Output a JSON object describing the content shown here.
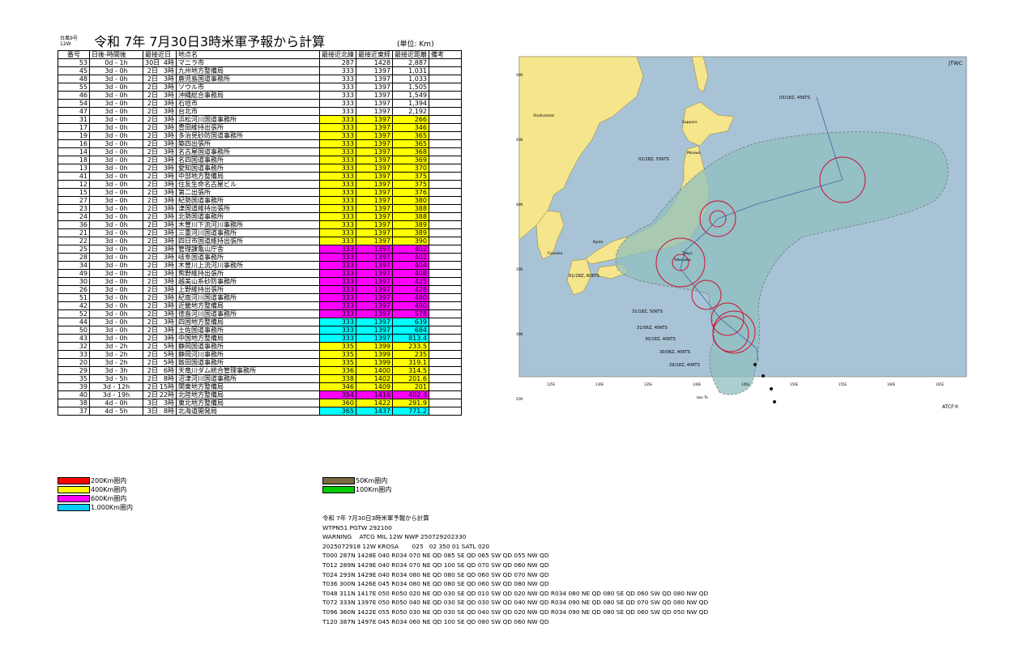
{
  "header": {
    "small_line1": "台風9号",
    "small_line2": "12W",
    "title": "令和 7年 7月30日3時米軍予報から計算",
    "unit": "(単位: Km)"
  },
  "table": {
    "columns": [
      "番号",
      "日後-時間後",
      "最接近日",
      "地点名",
      "最接近北緯",
      "最接近東経",
      "最接近距離",
      "備考"
    ],
    "rows": [
      {
        "no": "53",
        "offset": "0d - 1h",
        "day": "30日",
        "hour": "4時",
        "name": "マニラ市",
        "lat": "287",
        "lon": "1428",
        "dist": "2,887",
        "color": ""
      },
      {
        "no": "45",
        "offset": "3d - 0h",
        "day": "2日",
        "hour": "3時",
        "name": "九州地方整備局",
        "lat": "333",
        "lon": "1397",
        "dist": "1,031",
        "color": ""
      },
      {
        "no": "48",
        "offset": "3d - 0h",
        "day": "2日",
        "hour": "3時",
        "name": "鹿児島国道事務所",
        "lat": "333",
        "lon": "1397",
        "dist": "1,033",
        "color": ""
      },
      {
        "no": "55",
        "offset": "3d - 0h",
        "day": "2日",
        "hour": "3時",
        "name": "ソウル市",
        "lat": "333",
        "lon": "1397",
        "dist": "1,505",
        "color": ""
      },
      {
        "no": "46",
        "offset": "3d - 0h",
        "day": "2日",
        "hour": "3時",
        "name": "沖縄総合事務局",
        "lat": "333",
        "lon": "1397",
        "dist": "1,549",
        "color": ""
      },
      {
        "no": "54",
        "offset": "3d - 0h",
        "day": "2日",
        "hour": "3時",
        "name": "石垣市",
        "lat": "333",
        "lon": "1397",
        "dist": "1,394",
        "color": ""
      },
      {
        "no": "47",
        "offset": "3d - 0h",
        "day": "2日",
        "hour": "3時",
        "name": "台北市",
        "lat": "333",
        "lon": "1397",
        "dist": "2,192",
        "color": ""
      },
      {
        "no": "31",
        "offset": "3d - 0h",
        "day": "2日",
        "hour": "3時",
        "name": "浜松河川国道事務所",
        "lat": "333",
        "lon": "1397",
        "dist": "266",
        "color": "yellow"
      },
      {
        "no": "17",
        "offset": "3d - 0h",
        "day": "2日",
        "hour": "3時",
        "name": "豊田維持出張所",
        "lat": "333",
        "lon": "1397",
        "dist": "346",
        "color": "yellow"
      },
      {
        "no": "19",
        "offset": "3d - 0h",
        "day": "2日",
        "hour": "3時",
        "name": "多治見砂防国道事務所",
        "lat": "333",
        "lon": "1397",
        "dist": "365",
        "color": "yellow"
      },
      {
        "no": "16",
        "offset": "3d - 0h",
        "day": "2日",
        "hour": "3時",
        "name": "築四出張所",
        "lat": "333",
        "lon": "1397",
        "dist": "365",
        "color": "yellow"
      },
      {
        "no": "14",
        "offset": "3d - 0h",
        "day": "2日",
        "hour": "3時",
        "name": "名古屋国道事務所",
        "lat": "333",
        "lon": "1397",
        "dist": "368",
        "color": "yellow"
      },
      {
        "no": "18",
        "offset": "3d - 0h",
        "day": "2日",
        "hour": "3時",
        "name": "名四国道事務所",
        "lat": "333",
        "lon": "1397",
        "dist": "369",
        "color": "yellow"
      },
      {
        "no": "13",
        "offset": "3d - 0h",
        "day": "2日",
        "hour": "3時",
        "name": "愛知国道事務所",
        "lat": "333",
        "lon": "1397",
        "dist": "370",
        "color": "yellow"
      },
      {
        "no": "41",
        "offset": "3d - 0h",
        "day": "2日",
        "hour": "3時",
        "name": "中部地方整備局",
        "lat": "333",
        "lon": "1397",
        "dist": "375",
        "color": "yellow"
      },
      {
        "no": "12",
        "offset": "3d - 0h",
        "day": "2日",
        "hour": "3時",
        "name": "住友生命名古屋ビル",
        "lat": "333",
        "lon": "1397",
        "dist": "375",
        "color": "yellow"
      },
      {
        "no": "15",
        "offset": "3d - 0h",
        "day": "2日",
        "hour": "3時",
        "name": "第二出張所",
        "lat": "333",
        "lon": "1397",
        "dist": "376",
        "color": "yellow"
      },
      {
        "no": "27",
        "offset": "3d - 0h",
        "day": "2日",
        "hour": "3時",
        "name": "紀勢国道事務所",
        "lat": "333",
        "lon": "1397",
        "dist": "380",
        "color": "yellow"
      },
      {
        "no": "23",
        "offset": "3d - 0h",
        "day": "2日",
        "hour": "3時",
        "name": "津国道維持出張所",
        "lat": "333",
        "lon": "1397",
        "dist": "388",
        "color": "yellow"
      },
      {
        "no": "24",
        "offset": "3d - 0h",
        "day": "2日",
        "hour": "3時",
        "name": "北勢国道事務所",
        "lat": "333",
        "lon": "1397",
        "dist": "388",
        "color": "yellow"
      },
      {
        "no": "36",
        "offset": "3d - 0h",
        "day": "2日",
        "hour": "3時",
        "name": "木曽川下流河川事務所",
        "lat": "333",
        "lon": "1397",
        "dist": "389",
        "color": "yellow"
      },
      {
        "no": "21",
        "offset": "3d - 0h",
        "day": "2日",
        "hour": "3時",
        "name": "三重河川国道事務所",
        "lat": "333",
        "lon": "1397",
        "dist": "389",
        "color": "yellow"
      },
      {
        "no": "22",
        "offset": "3d - 0h",
        "day": "2日",
        "hour": "3時",
        "name": "四日市国道維持出張所",
        "lat": "333",
        "lon": "1397",
        "dist": "390",
        "color": "yellow"
      },
      {
        "no": "25",
        "offset": "3d - 0h",
        "day": "2日",
        "hour": "3時",
        "name": "管理課亀山庁舎",
        "lat": "333",
        "lon": "1397",
        "dist": "402",
        "color": "magenta"
      },
      {
        "no": "28",
        "offset": "3d - 0h",
        "day": "2日",
        "hour": "3時",
        "name": "岐阜国道事務所",
        "lat": "333",
        "lon": "1397",
        "dist": "402",
        "color": "magenta"
      },
      {
        "no": "34",
        "offset": "3d - 0h",
        "day": "2日",
        "hour": "3時",
        "name": "木曽川上流河川事務所",
        "lat": "333",
        "lon": "1397",
        "dist": "404",
        "color": "magenta"
      },
      {
        "no": "49",
        "offset": "3d - 0h",
        "day": "2日",
        "hour": "3時",
        "name": "熊野維持出張所",
        "lat": "333",
        "lon": "1397",
        "dist": "408",
        "color": "magenta"
      },
      {
        "no": "30",
        "offset": "3d - 0h",
        "day": "2日",
        "hour": "3時",
        "name": "越美山系砂防事務所",
        "lat": "333",
        "lon": "1397",
        "dist": "425",
        "color": "magenta"
      },
      {
        "no": "26",
        "offset": "3d - 0h",
        "day": "2日",
        "hour": "3時",
        "name": "上野維持出張所",
        "lat": "333",
        "lon": "1397",
        "dist": "428",
        "color": "magenta"
      },
      {
        "no": "51",
        "offset": "3d - 0h",
        "day": "2日",
        "hour": "3時",
        "name": "紀南河川国道事務所",
        "lat": "333",
        "lon": "1397",
        "dist": "480",
        "color": "magenta"
      },
      {
        "no": "42",
        "offset": "3d - 0h",
        "day": "2日",
        "hour": "3時",
        "name": "近畿地方整備局",
        "lat": "333",
        "lon": "1397",
        "dist": "490",
        "color": "magenta"
      },
      {
        "no": "52",
        "offset": "3d - 0h",
        "day": "2日",
        "hour": "3時",
        "name": "徳島河川国道事務所",
        "lat": "333",
        "lon": "1397",
        "dist": "578",
        "color": "magenta"
      },
      {
        "no": "44",
        "offset": "3d - 0h",
        "day": "2日",
        "hour": "3時",
        "name": "四国地方整備局",
        "lat": "333",
        "lon": "1397",
        "dist": "639",
        "color": "cyan"
      },
      {
        "no": "50",
        "offset": "3d - 0h",
        "day": "2日",
        "hour": "3時",
        "name": "土佐国道事務所",
        "lat": "333",
        "lon": "1397",
        "dist": "684",
        "color": "cyan"
      },
      {
        "no": "43",
        "offset": "3d - 0h",
        "day": "2日",
        "hour": "3時",
        "name": "中国地方整備局",
        "lat": "333",
        "lon": "1397",
        "dist": "813.4",
        "color": "cyan"
      },
      {
        "no": "32",
        "offset": "3d - 2h",
        "day": "2日",
        "hour": "5時",
        "name": "静岡国道事務所",
        "lat": "335",
        "lon": "1399",
        "dist": "233.5",
        "color": "yellow"
      },
      {
        "no": "33",
        "offset": "3d - 2h",
        "day": "2日",
        "hour": "5時",
        "name": "静岡河川事務所",
        "lat": "335",
        "lon": "1399",
        "dist": "235",
        "color": "yellow"
      },
      {
        "no": "20",
        "offset": "3d - 2h",
        "day": "2日",
        "hour": "5時",
        "name": "飯田国道事務所",
        "lat": "335",
        "lon": "1399",
        "dist": "319.1",
        "color": "yellow"
      },
      {
        "no": "29",
        "offset": "3d - 3h",
        "day": "2日",
        "hour": "6時",
        "name": "天竜川ダム統合管理事務所",
        "lat": "336",
        "lon": "1400",
        "dist": "314.5",
        "color": "yellow"
      },
      {
        "no": "35",
        "offset": "3d - 5h",
        "day": "2日",
        "hour": "8時",
        "name": "沼津河川国道事務所",
        "lat": "338",
        "lon": "1402",
        "dist": "201.6",
        "color": "yellow"
      },
      {
        "no": "39",
        "offset": "3d - 12h",
        "day": "2日",
        "hour": "15時",
        "name": "関東地方整備局",
        "lat": "346",
        "lon": "1409",
        "dist": "201",
        "color": "yellow"
      },
      {
        "no": "40",
        "offset": "3d - 19h",
        "day": "2日",
        "hour": "22時",
        "name": "北陸地方整備局",
        "lat": "354",
        "lon": "1416",
        "dist": "402.4",
        "color": "magenta"
      },
      {
        "no": "38",
        "offset": "4d - 0h",
        "day": "3日",
        "hour": "3時",
        "name": "東北地方整備局",
        "lat": "360",
        "lon": "1422",
        "dist": "291.9",
        "color": "yellow"
      },
      {
        "no": "37",
        "offset": "4d - 5h",
        "day": "3日",
        "hour": "8時",
        "name": "北海道開発局",
        "lat": "365",
        "lon": "1437",
        "dist": "771.2",
        "color": "cyan"
      }
    ]
  },
  "legend": [
    {
      "label": "200Km圏内",
      "color": "#ff0000"
    },
    {
      "label": "400Km圏内",
      "color": "#ffff00"
    },
    {
      "label": "600Km圏内",
      "color": "#ff00ff"
    },
    {
      "label": "1,000Km圏内",
      "color": "#00ccff"
    },
    {
      "label": "50Km圏内",
      "color": "#7a6a40"
    },
    {
      "label": "100Km圏内",
      "color": "#00cc00"
    }
  ],
  "colors": {
    "yellow": "#ffff00",
    "magenta": "#ff00ff",
    "cyan": "#00ffff"
  },
  "bulletin": [
    "令和 7年 7月30日3時米軍予報から計算",
    "WTPN51 PGTW 292100",
    "WARNING    ATCG MIL 12W NWP 250729202330",
    "2025072918 12W KROSA       025   02 350 01 SATL 020",
    "T000 287N 1428E 040 R034 070 NE QD 085 SE QD 065 SW QD 055 NW QD",
    "T012 289N 1429E 040 R034 070 NE QD 100 SE QD 070 SW QD 060 NW QD",
    "T024 293N 1429E 040 R034 080 NE QD 080 SE QD 060 SW QD 070 NW QD",
    "T036 300N 1426E 045 R034 080 NE QD 080 SE QD 060 SW QD 080 NW QD",
    "T048 311N 1417E 050 R050 020 NE QD 030 SE QD 010 SW QD 020 NW QD R034 080 NE QD 080 SE QD 060 SW QD 080 NW QD",
    "T072 333N 1397E 050 R050 040 NE QD 030 SE QD 030 SW QD 040 NW QD R034 090 NE QD 080 SE QD 070 SW QD 080 NW QD",
    "T096 360N 1422E 055 R050 030 NE QD 030 SE QD 040 SW QD 020 NW QD R034 090 NE QD 080 SE QD 060 SW QD 050 NW QD",
    "T120 387N 1497E 045 R034 060 NE QD 100 SE QD 080 SW QD 060 NW QD"
  ],
  "map": {
    "corner_label": "JTWC",
    "credit": "ATCF®",
    "place_names": [
      "Vladivostok",
      "Sapporo",
      "Misawa",
      "Tokyo",
      "Yokosuka",
      "Kyoto",
      "Fukuoka",
      "Iwo To"
    ],
    "forecast_labels": [
      "03/18Z, 45KTS",
      "02/18Z, 55KTS",
      "01/18Z, 60KTS",
      "31/18Z, 50KTS",
      "31/06Z, 45KTS",
      "30/18Z, 40KTS",
      "30/06Z, 40KTS",
      "29/18Z, 40KTS"
    ],
    "lon_ticks": [
      "125E",
      "130E",
      "135E",
      "140E",
      "145E",
      "150E",
      "155E",
      "160E",
      "165E"
    ],
    "lat_ticks": [
      "50N",
      "45N",
      "40N",
      "35N",
      "30N",
      "25N"
    ],
    "colors": {
      "sea": "#a9c3d6",
      "land": "#f5e58c",
      "cone": "#8fbfbf",
      "track": "#4b6fa8",
      "circle": "#cc1133"
    }
  }
}
